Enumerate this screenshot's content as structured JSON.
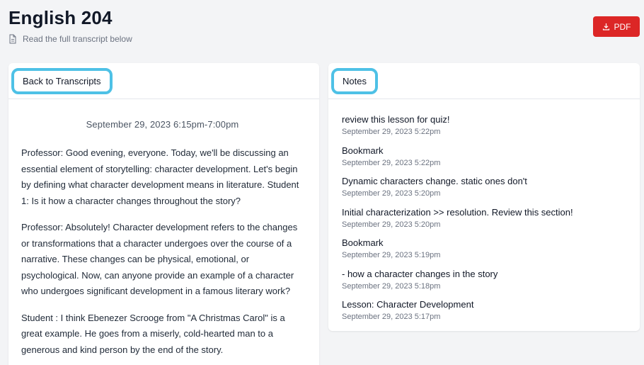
{
  "header": {
    "title": "English 204",
    "subtitle": "Read the full transcript below",
    "pdf_label": "PDF"
  },
  "transcript": {
    "back_label": "Back to Transcripts",
    "date": "September 29, 2023 6:15pm-7:00pm",
    "paragraphs": [
      "Professor: Good evening, everyone. Today, we'll be discussing an essential element of storytelling: character development. Let's begin by defining what character development means in literature. Student 1: Is it how a character changes throughout the story?",
      "Professor: Absolutely! Character development refers to the changes or transformations that a character undergoes over the course of a narrative. These changes can be physical, emotional, or psychological. Now, can anyone provide an example of a character who undergoes significant development in a famous literary work?",
      "Student : I think Ebenezer Scrooge from \"A Christmas Carol\" is a great example. He goes from a miserly, cold-hearted man to a generous and kind person by the end of the story."
    ]
  },
  "notes": {
    "title": "Notes",
    "items": [
      {
        "text": "review this lesson for quiz!",
        "time": "September 29, 2023 5:22pm"
      },
      {
        "text": "Bookmark",
        "time": "September 29, 2023 5:22pm"
      },
      {
        "text": "Dynamic characters change. static ones don't",
        "time": "September 29, 2023 5:20pm"
      },
      {
        "text": "Initial characterization >> resolution. Review this section!",
        "time": "September 29, 2023 5:20pm"
      },
      {
        "text": "Bookmark",
        "time": "September 29, 2023 5:19pm"
      },
      {
        "text": "- how a character changes in the story",
        "time": "September 29, 2023 5:18pm"
      },
      {
        "text": "Lesson: Character Development",
        "time": "September 29, 2023 5:17pm"
      }
    ]
  },
  "colors": {
    "accent_red": "#dc2626",
    "highlight_outline": "#4ec1e6",
    "background": "#f3f4f6"
  },
  "icons": {
    "subtitle_icon": "document-icon",
    "pdf_icon": "download-icon"
  }
}
